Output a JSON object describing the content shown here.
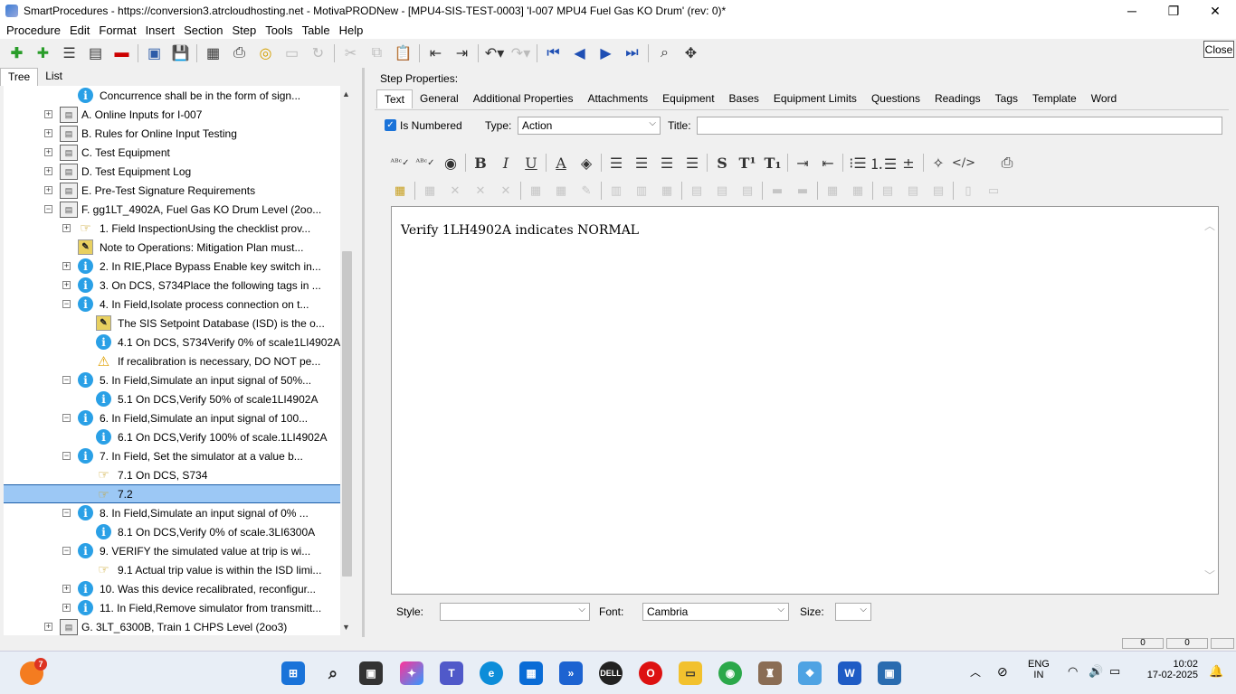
{
  "window": {
    "title": "SmartProcedures - https://conversion3.atrcloudhosting.net - MotivaPRODNew - [MPU4-SIS-TEST-0003] 'I-007 MPU4 Fuel Gas KO Drum' (rev: 0)*",
    "minimize": "─",
    "maximize": "❐",
    "close": "✕"
  },
  "menu": [
    "Procedure",
    "Edit",
    "Format",
    "Insert",
    "Section",
    "Step",
    "Tools",
    "Table",
    "Help"
  ],
  "close_label": "Close",
  "left_tabs": [
    "Tree",
    "List"
  ],
  "tree": [
    {
      "indent": 2,
      "exp": "",
      "icon": "info",
      "label": "Concurrence shall be in the form of sign..."
    },
    {
      "indent": 1,
      "exp": "+",
      "icon": "doc",
      "label": "A. Online Inputs for I-007"
    },
    {
      "indent": 1,
      "exp": "+",
      "icon": "doc",
      "label": "B. Rules for Online Input Testing"
    },
    {
      "indent": 1,
      "exp": "+",
      "icon": "doc",
      "label": "C. Test Equipment"
    },
    {
      "indent": 1,
      "exp": "+",
      "icon": "doc",
      "label": "D. Test Equipment Log"
    },
    {
      "indent": 1,
      "exp": "+",
      "icon": "doc",
      "label": "E. Pre-Test Signature Requirements"
    },
    {
      "indent": 1,
      "exp": "−",
      "icon": "doc",
      "label": "F. gg1LT_4902A, Fuel Gas KO Drum Level (2oo..."
    },
    {
      "indent": 2,
      "exp": "+",
      "icon": "hand",
      "label": "1. Field InspectionUsing the checklist prov..."
    },
    {
      "indent": 2,
      "exp": "",
      "icon": "note",
      "label": "Note to Operations: Mitigation Plan must..."
    },
    {
      "indent": 2,
      "exp": "+",
      "icon": "info",
      "label": "2. In RIE,Place Bypass Enable key switch in..."
    },
    {
      "indent": 2,
      "exp": "+",
      "icon": "info",
      "label": "3. On DCS, S734Place the following tags in ..."
    },
    {
      "indent": 2,
      "exp": "−",
      "icon": "info",
      "label": "4. In Field,Isolate process connection on t..."
    },
    {
      "indent": 3,
      "exp": "",
      "icon": "note",
      "label": "The SIS Setpoint Database (ISD) is the o..."
    },
    {
      "indent": 3,
      "exp": "",
      "icon": "info",
      "label": "4.1 On DCS, S734Verify 0% of scale1LI4902A"
    },
    {
      "indent": 3,
      "exp": "",
      "icon": "warn",
      "label": "If recalibration is necessary, DO NOT pe..."
    },
    {
      "indent": 2,
      "exp": "−",
      "icon": "info",
      "label": "5. In Field,Simulate an input signal of 50%..."
    },
    {
      "indent": 3,
      "exp": "",
      "icon": "info",
      "label": "5.1 On DCS,Verify 50% of scale1LI4902A"
    },
    {
      "indent": 2,
      "exp": "−",
      "icon": "info",
      "label": "6. In Field,Simulate an input signal of 100..."
    },
    {
      "indent": 3,
      "exp": "",
      "icon": "info",
      "label": "6.1 On DCS,Verify 100% of scale.1LI4902A"
    },
    {
      "indent": 2,
      "exp": "−",
      "icon": "info",
      "label": "7. In Field, Set the simulator at a value b..."
    },
    {
      "indent": 3,
      "exp": "",
      "icon": "hand",
      "label": "7.1 On DCS, S734"
    },
    {
      "indent": 3,
      "exp": "",
      "icon": "hand",
      "label": "7.2",
      "selected": true
    },
    {
      "indent": 2,
      "exp": "−",
      "icon": "info",
      "label": "8. In Field,Simulate an input signal of 0% ..."
    },
    {
      "indent": 3,
      "exp": "",
      "icon": "info",
      "label": "8.1 On DCS,Verify 0% of scale.3LI6300A"
    },
    {
      "indent": 2,
      "exp": "−",
      "icon": "info",
      "label": "9. VERIFY the simulated value at trip is wi..."
    },
    {
      "indent": 3,
      "exp": "",
      "icon": "hand",
      "label": "9.1 Actual trip value is within the ISD limi..."
    },
    {
      "indent": 2,
      "exp": "+",
      "icon": "info",
      "label": "10. Was this device recalibrated, reconfigur..."
    },
    {
      "indent": 2,
      "exp": "+",
      "icon": "info",
      "label": "11. In Field,Remove simulator from transmitt..."
    },
    {
      "indent": 1,
      "exp": "+",
      "icon": "doc",
      "label": "G. 3LT_6300B, Train 1 CHPS Level (2oo3)"
    }
  ],
  "step_properties": {
    "heading": "Step Properties:",
    "tabs": [
      "Text",
      "General",
      "Additional Properties",
      "Attachments",
      "Equipment",
      "Bases",
      "Equipment Limits",
      "Questions",
      "Readings",
      "Tags",
      "Template",
      "Word"
    ],
    "is_numbered_label": "Is Numbered",
    "type_label": "Type:",
    "type_value": "Action",
    "title_label": "Title:",
    "title_value": ""
  },
  "editor_text": "Verify 1LH4902A  indicates NORMAL",
  "bottom": {
    "style_label": "Style:",
    "style_value": "",
    "font_label": "Font:",
    "font_value": "Cambria",
    "size_label": "Size:",
    "size_value": ""
  },
  "status": [
    "0",
    "0"
  ],
  "taskbar": {
    "badge": "7",
    "lang1": "ENG",
    "lang2": "IN",
    "time": "10:02",
    "date": "17-02-2025"
  }
}
